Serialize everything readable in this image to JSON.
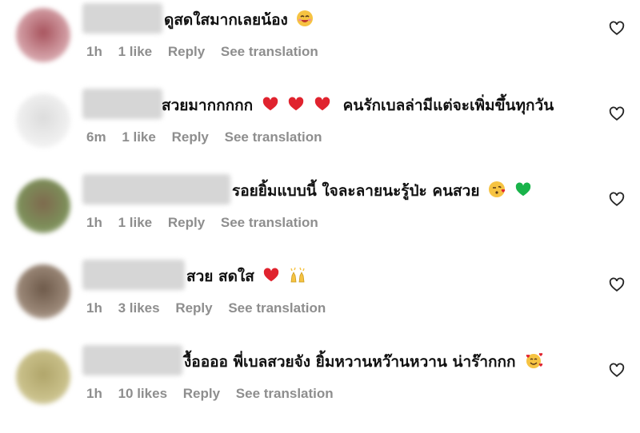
{
  "comments": [
    {
      "text": "ดูสดใสมากเลยน้อง",
      "emojis": [
        "smiling-face-icon"
      ],
      "time": "1h",
      "likes": "1 like",
      "reply": "Reply",
      "translate": "See translation",
      "avatar_color": "#b7737a"
    },
    {
      "text": "สวยมากกกกก",
      "text2": "คนรักเบลล่ามีแต่จะเพิ่มขึ้นทุกวัน",
      "emojis": [
        "red-heart-icon",
        "red-heart-icon",
        "red-heart-icon"
      ],
      "time": "6m",
      "likes": "1 like",
      "reply": "Reply",
      "translate": "See translation",
      "avatar_color": "#e8e8e8"
    },
    {
      "text": "รอยยิ้มแบบนี้ ใจละลายนะรู้ป่ะ คนสวย",
      "emojis": [
        "kissing-face-icon",
        "green-heart-icon"
      ],
      "time": "1h",
      "likes": "1 like",
      "reply": "Reply",
      "translate": "See translation",
      "avatar_color": "#7d8f5a"
    },
    {
      "text": "สวย สดใส",
      "emojis": [
        "red-heart-icon",
        "raising-hands-icon"
      ],
      "time": "1h",
      "likes": "3 likes",
      "reply": "Reply",
      "translate": "See translation",
      "avatar_color": "#9a8777"
    },
    {
      "text": "งื้ออออ พี่เบลสวยจัง ยิ้มหวานหว๊านหวาน น่าร๊ากกก",
      "emojis": [
        "smiling-face-with-hearts-icon"
      ],
      "time": "1h",
      "likes": "10 likes",
      "reply": "Reply",
      "translate": "See translation",
      "avatar_color": "#c9c08a"
    }
  ],
  "colors": {
    "text": "#111111",
    "meta": "#8e8e8e",
    "heart_red": "#e0232e",
    "heart_green": "#19b34a",
    "emoji_yellow": "#f6c342"
  }
}
